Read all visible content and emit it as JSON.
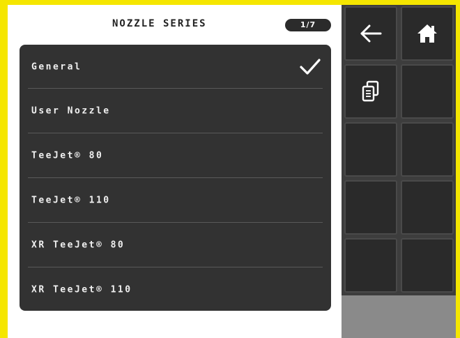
{
  "header": {
    "title": "NOZZLE SERIES",
    "page_indicator": "1/7"
  },
  "nozzle_list": {
    "selected_index": 0,
    "items": [
      {
        "label": "General",
        "selected": true
      },
      {
        "label": "User Nozzle",
        "selected": false
      },
      {
        "label": "TeeJet® 80",
        "selected": false
      },
      {
        "label": "TeeJet® 110",
        "selected": false
      },
      {
        "label": "XR TeeJet® 80",
        "selected": false
      },
      {
        "label": "XR TeeJet® 110",
        "selected": false
      }
    ]
  },
  "softkeys": {
    "buttons": [
      {
        "icon": "back-arrow-icon"
      },
      {
        "icon": "home-icon"
      },
      {
        "icon": "copy-icon"
      },
      {
        "icon": ""
      },
      {
        "icon": ""
      },
      {
        "icon": ""
      },
      {
        "icon": ""
      },
      {
        "icon": ""
      },
      {
        "icon": ""
      },
      {
        "icon": ""
      }
    ]
  },
  "colors": {
    "frame": "#f5e600",
    "list_background": "#323232",
    "softkey_background": "#2a2a2a",
    "text": "#f0f0f0"
  }
}
